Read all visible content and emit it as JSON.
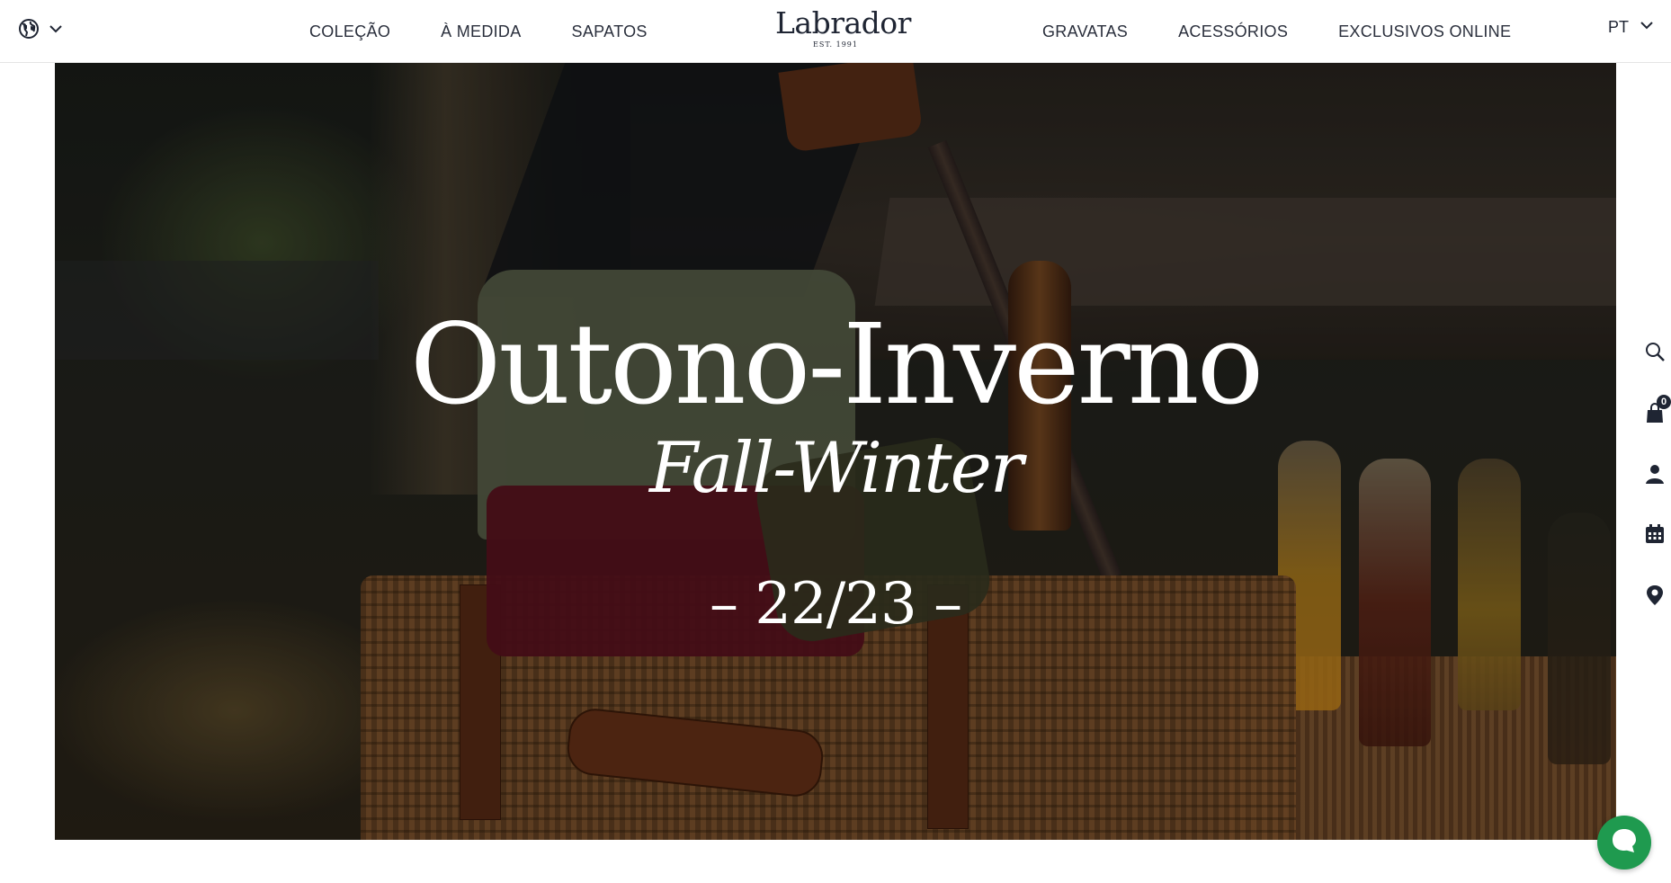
{
  "header": {
    "globe_icon": "globe-icon",
    "nav_left": [
      "COLEÇÃO",
      "À MEDIDA",
      "SAPATOS"
    ],
    "nav_right": [
      "GRAVATAS",
      "ACESSÓRIOS",
      "EXCLUSIVOS ONLINE"
    ],
    "logo": {
      "name": "Labrador",
      "est": "EST. 1991"
    },
    "language": "PT"
  },
  "hero": {
    "title": "Outono-Inverno",
    "subtitle": "Fall-Winter",
    "season": "– 22/23 –"
  },
  "side_toolbar": {
    "icons": [
      "search-icon",
      "bag-icon",
      "user-icon",
      "calendar-icon",
      "location-pin-icon"
    ],
    "cart_count": "0"
  },
  "chat": {
    "icon": "chat-bubble-icon",
    "color": "#1f9a4f"
  },
  "colors": {
    "text": "#1f2533",
    "background": "#ffffff"
  }
}
